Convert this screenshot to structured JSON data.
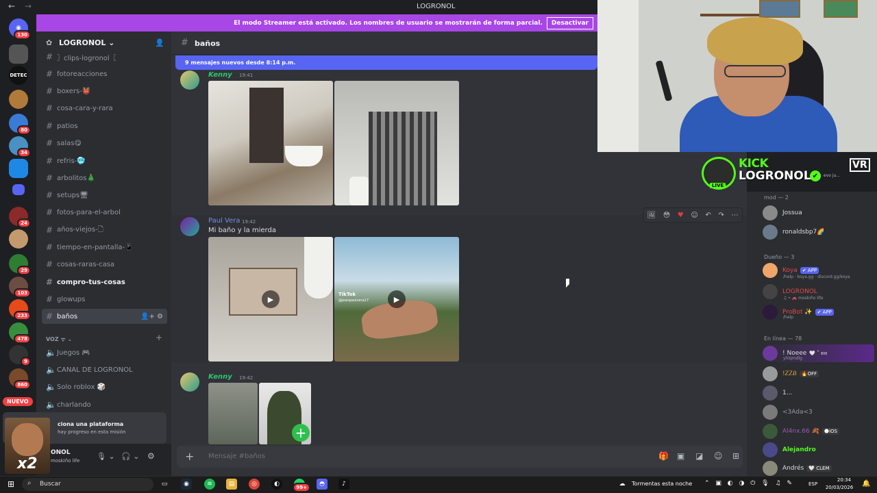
{
  "titlebar": {
    "back": "←",
    "forward": "→",
    "title": "LOGRONOL"
  },
  "banner": {
    "text": "El modo Streamer está activado. Los nombres de usuario se mostrarán de forma parcial.",
    "button": "Desactivar"
  },
  "rail": {
    "badges": [
      "130",
      "80",
      "34",
      "24",
      "29",
      "103",
      "233",
      "478",
      "9",
      "860"
    ],
    "new_label": "NUEVO",
    "detec_label": "DETEC"
  },
  "server": {
    "name": "LOGRONOL"
  },
  "channels": [
    {
      "name": "〗clips-logronol〖",
      "bold": false
    },
    {
      "name": "fotoreacciones",
      "bold": false
    },
    {
      "name": "boxers-👹",
      "bold": false
    },
    {
      "name": "cosa-cara-y-rara",
      "bold": false
    },
    {
      "name": "patios",
      "bold": false
    },
    {
      "name": "salas😋",
      "bold": false
    },
    {
      "name": "refris-🥶",
      "bold": false
    },
    {
      "name": "arbolitos🎄",
      "bold": false
    },
    {
      "name": "setups🖥",
      "bold": false
    },
    {
      "name": "fotos-para-el-arbol",
      "bold": false
    },
    {
      "name": "años-viejos-🗋",
      "bold": false
    },
    {
      "name": "tiempo-en-pantalla-📱",
      "bold": false
    },
    {
      "name": "cosas-raras-casa",
      "bold": false
    },
    {
      "name": "compro-tus-cosas",
      "bold": true
    },
    {
      "name": "glowups",
      "bold": false
    },
    {
      "name": "baños",
      "bold": false,
      "active": true
    }
  ],
  "voice": {
    "header": "VOZ ᯤ",
    "channels": [
      "Juegos 🎮",
      "CANAL DE LOGRONOL",
      "Solo roblox 🎲",
      "charlando"
    ]
  },
  "mission": {
    "title": "ciona una plataforma",
    "subtitle": "hay progreso en esta misión"
  },
  "user": {
    "name": "ONOL",
    "status": "moskiño life",
    "meme_label": "x2"
  },
  "chat": {
    "channel": "baños",
    "new_messages": "9 mensajes nuevos desde 8:14 p.m.",
    "messages": [
      {
        "author": "Kenny",
        "time": "19:41",
        "color": "#2dc770"
      },
      {
        "author": "Paul Vera",
        "time": "19:42",
        "color": "#7b8cde",
        "text": "Mi baño y la mierda"
      },
      {
        "author": "Kenny",
        "time": "19:42",
        "color": "#2dc770"
      }
    ],
    "tiktok_label": "TikTok",
    "tiktok_user": "@jeanpaulvera17",
    "composer_placeholder": "Mensaje #baños"
  },
  "members": {
    "groups": [
      {
        "label": "mod — 2"
      },
      {
        "label": "Dueño — 3"
      },
      {
        "label": "En línea — 78"
      }
    ],
    "mods": [
      {
        "name": "Jossua",
        "color": "#dbdee1"
      },
      {
        "name": "ronaldsbp7🌈",
        "color": "#dbdee1"
      }
    ],
    "owners": [
      {
        "name": "Koya",
        "tag": "✔ APP",
        "sub": "/help · koya.gg · discord.gg/koya",
        "color": "#e04a4a"
      },
      {
        "name": "LOGRONOL",
        "sub": "♫ • 🚗 moskiño life",
        "color": "#e04a4a"
      },
      {
        "name": "ProBot ✨",
        "tag": "✔ APP",
        "sub": "/help",
        "color": "#e04a4a"
      }
    ],
    "online": [
      {
        "name": "! Noeee",
        "extra": "🤍 ˚ ʚɞ",
        "sub": "yhlqmdlg",
        "color": "#dbdee1"
      },
      {
        "name": "!ᏃᏃᏰ",
        "extra": "🔥OFF",
        "color": "#e8a33d"
      },
      {
        "name": "1...",
        "color": "#dbdee1"
      },
      {
        "name": "<3Ada<3",
        "color": "#949ba4"
      },
      {
        "name": "Al4nx.66 🍂",
        "extra": "🌑iOS",
        "color": "#9b59b6"
      },
      {
        "name": "Alejandro",
        "color": "#53fc18"
      },
      {
        "name": "Andrés",
        "extra": "🤍 CLEM",
        "color": "#dbdee1"
      }
    ]
  },
  "kick": {
    "brand": "KICK",
    "name": "LOGRONOL",
    "live": "LIVE",
    "note": "evo ju...",
    "vr": "VR"
  },
  "taskbar": {
    "search": "Buscar",
    "whatsapp_badge": "99+",
    "weather": "Tormentas esta noche",
    "lang": "ESP",
    "time": "20:34",
    "date": "20/03/2026"
  }
}
